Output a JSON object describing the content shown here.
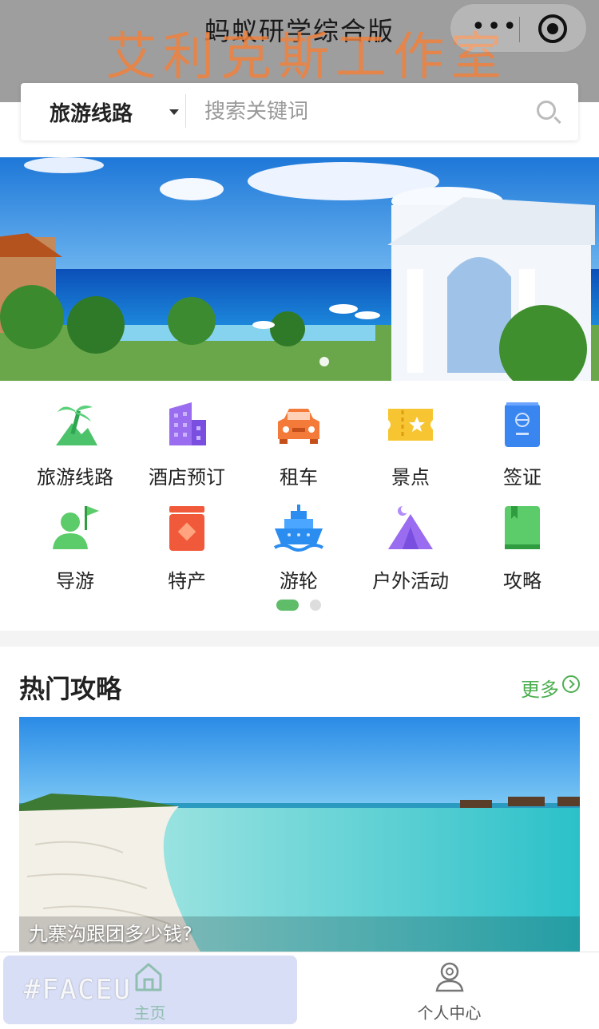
{
  "navbar": {
    "title": "蚂蚁研学综合版",
    "watermark": "艾利克斯工作室"
  },
  "search": {
    "category": "旅游线路",
    "placeholder": "搜索关键词"
  },
  "grid": {
    "items": [
      {
        "label": "旅游线路",
        "icon": "palm-tree-icon"
      },
      {
        "label": "酒店预订",
        "icon": "hotel-building-icon"
      },
      {
        "label": "租车",
        "icon": "car-icon"
      },
      {
        "label": "景点",
        "icon": "ticket-icon"
      },
      {
        "label": "签证",
        "icon": "passport-icon"
      },
      {
        "label": "导游",
        "icon": "guide-flag-icon"
      },
      {
        "label": "特产",
        "icon": "specialty-box-icon"
      },
      {
        "label": "游轮",
        "icon": "cruise-ship-icon"
      },
      {
        "label": "户外活动",
        "icon": "tent-icon"
      },
      {
        "label": "攻略",
        "icon": "guide-book-icon"
      }
    ]
  },
  "section": {
    "title": "热门攻略",
    "more": "更多"
  },
  "card": {
    "title": "九寨沟跟团多少钱?"
  },
  "tabbar": {
    "home": "主页",
    "me": "个人中心"
  },
  "overlay": {
    "faceu": "#FACEU"
  }
}
